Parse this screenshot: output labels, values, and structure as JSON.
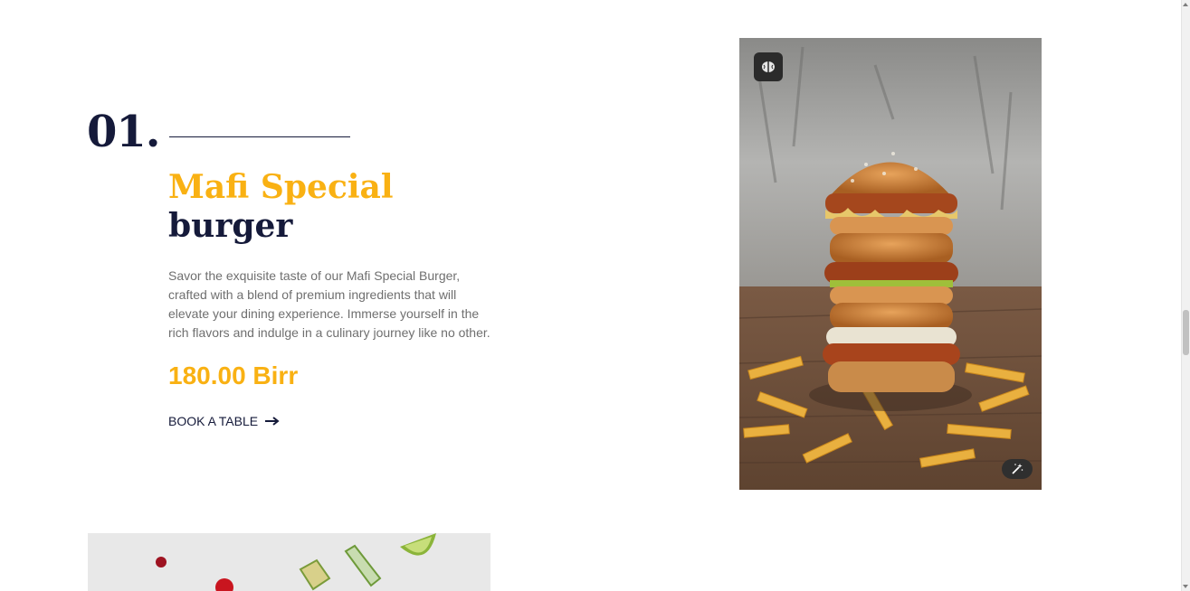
{
  "menu_item": {
    "number": "01.",
    "title_line1": "Mafi Special",
    "title_line2": "burger",
    "description": "Savor the exquisite taste of our Mafi Special Burger, crafted with a blend of premium ingredients that will elevate your dining experience. Immerse yourself in the rich flavors and indulge in a culinary journey like no other.",
    "price": "180.00 Birr",
    "cta_label": "BOOK A TABLE"
  },
  "images": {
    "main_image_icon": "brain-icon",
    "edit_image_icon": "magic-wand-icon"
  },
  "colors": {
    "accent": "#f9b113",
    "dark": "#151a3a",
    "text_muted": "#6f6f6f"
  }
}
